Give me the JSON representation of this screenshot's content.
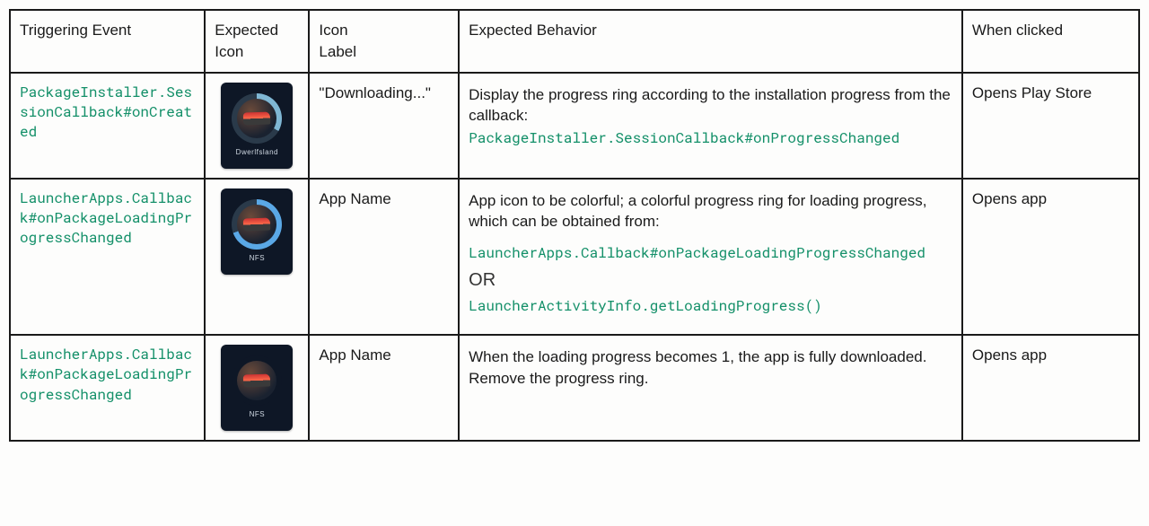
{
  "headers": {
    "triggering_event": "Triggering Event",
    "expected_icon": "Expected Icon",
    "icon_label": "Icon\nLabel",
    "expected_behavior": "Expected Behavior",
    "when_clicked": "When clicked"
  },
  "rows": [
    {
      "trigger_code": "PackageInstaller.SessionCallback#onCreated",
      "icon_caption": "Dwerlfsland",
      "icon_state": "partial",
      "icon_label": "\"Downloading...\"",
      "behavior_pre": "Display the progress ring according to the installation progress from the callback:",
      "behavior_code1": "PackageInstaller.SessionCallback#onProgressChanged",
      "behavior_or": "",
      "behavior_code2": "",
      "when_clicked": "Opens Play Store"
    },
    {
      "trigger_code": "LauncherApps.Callback#onPackageLoadingProgressChanged",
      "icon_caption": "NFS",
      "icon_state": "loading",
      "icon_label": "App Name",
      "behavior_pre": "App icon to be colorful; a colorful progress ring for loading progress, which can be obtained from:",
      "behavior_code1": "LauncherApps.Callback#onPackageLoadingProgressChanged",
      "behavior_or": "OR",
      "behavior_code2": "LauncherActivityInfo.getLoadingProgress()",
      "when_clicked": "Opens app"
    },
    {
      "trigger_code": "LauncherApps.Callback#onPackageLoadingProgressChanged",
      "icon_caption": "NFS",
      "icon_state": "full",
      "icon_label": "App Name",
      "behavior_pre": "When the loading progress becomes 1, the app is fully downloaded. Remove the progress ring.",
      "behavior_code1": "",
      "behavior_or": "",
      "behavior_code2": "",
      "when_clicked": "Opens app"
    }
  ]
}
